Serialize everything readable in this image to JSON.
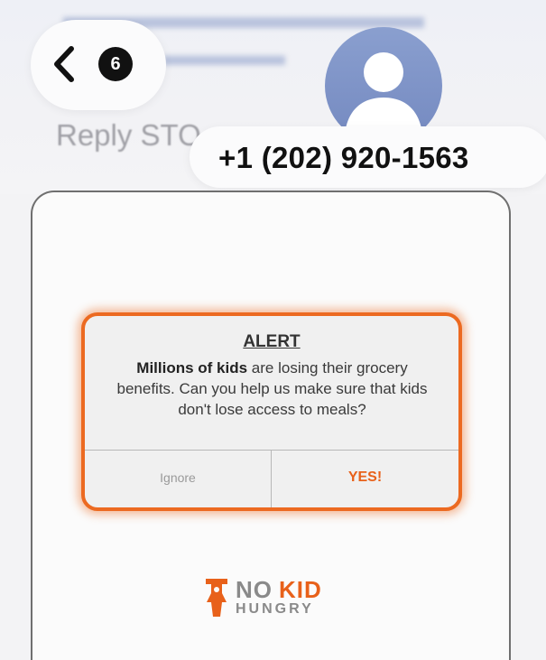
{
  "header": {
    "unread_count": "6",
    "reply_preview": "Reply STO",
    "phone_number": "+1 (202) 920-1563"
  },
  "message": {
    "alert": {
      "title": "ALERT",
      "body_bold": "Millions of kids",
      "body_rest": " are losing their grocery benefits. Can you help us make sure that kids don't lose access to meals?",
      "ignore_label": "Ignore",
      "yes_label": "YES!"
    },
    "logo": {
      "word_no": "NO",
      "word_kid": "KID",
      "word_hungry": "HUNGRY"
    }
  },
  "colors": {
    "accent_orange": "#e8611a",
    "avatar_blue": "#7f94c8",
    "badge_black": "#111111"
  },
  "icons": [
    "chevron-left-icon",
    "contact-avatar-icon",
    "no-kid-hungry-figure-icon"
  ]
}
